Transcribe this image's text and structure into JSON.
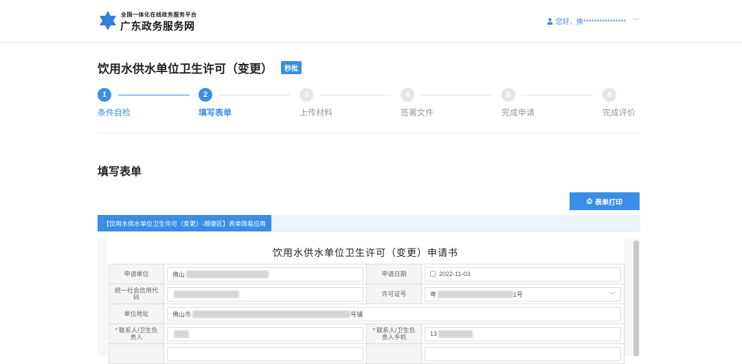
{
  "header": {
    "brand_sub": "全国一体化在线政务服务平台",
    "brand_main": "广东政务服务网",
    "user_greeting": "您好，佛****************",
    "icons": {
      "logo": "snowflake-logo-icon",
      "user": "person-icon",
      "dropdown": "chevron-down-icon"
    }
  },
  "page": {
    "title": "饮用水供水单位卫生许可（变更）",
    "badge": "秒批"
  },
  "steps": [
    {
      "num": "1",
      "label": "条件自检",
      "state": "done"
    },
    {
      "num": "2",
      "label": "填写表单",
      "state": "current"
    },
    {
      "num": "3",
      "label": "上传材料",
      "state": "todo"
    },
    {
      "num": "4",
      "label": "签署文件",
      "state": "todo"
    },
    {
      "num": "5",
      "label": "完成申请",
      "state": "todo"
    },
    {
      "num": "6",
      "label": "完成评价",
      "state": "todo"
    }
  ],
  "section_title": "填写表单",
  "print_button": "表单打印",
  "tab_label": "【饮用水供水单位卫生许可（变更）-顺德区】表单简易应用",
  "form": {
    "title": "饮用水供水单位卫生许可（变更）申请书",
    "fields": {
      "applicant_label": "申请单位",
      "applicant_value": "佛山",
      "date_label": "申请日期",
      "date_value": "2022-11-03",
      "credit_code_label": "统一社会信用代码",
      "credit_code_value": "",
      "license_label": "许可证号",
      "license_prefix": "粤",
      "license_suffix": "1号",
      "address_label": "单位地址",
      "address_prefix": "佛山市",
      "address_suffix": "号铺",
      "contact_label": "联系人/卫生负责人",
      "contact_value": "",
      "phone_label": "联系人/卫生负责人手机",
      "phone_value": "13"
    }
  },
  "colors": {
    "accent": "#3a8ee6",
    "required": "#e33333"
  }
}
